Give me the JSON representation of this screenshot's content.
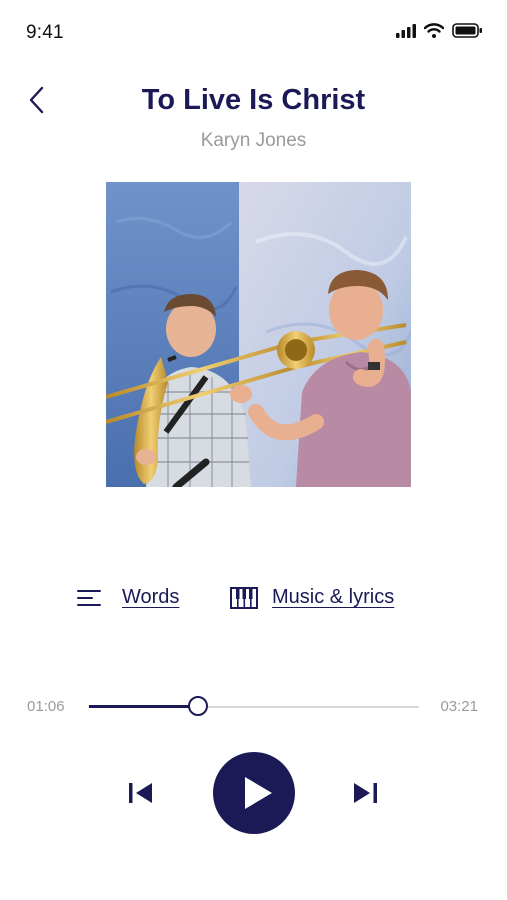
{
  "status_bar": {
    "time": "9:41",
    "icons": [
      "cellular-signal-icon",
      "wifi-icon",
      "battery-icon"
    ]
  },
  "header": {
    "back_icon": "chevron-left-icon",
    "title": "To Live Is Christ",
    "artist": "Karyn Jones"
  },
  "artwork": {
    "description_icon": "album-art-image"
  },
  "links": {
    "words": {
      "label": "Words",
      "icon": "text-lines-icon"
    },
    "music": {
      "label": "Music & lyrics",
      "icon": "piano-keys-icon"
    }
  },
  "player": {
    "current_time": "01:06",
    "total_time": "03:21",
    "progress": 0.33,
    "prev_icon": "skip-previous-icon",
    "play_icon": "play-icon",
    "next_icon": "skip-next-icon"
  },
  "colors": {
    "accent": "#1b1a57",
    "muted": "#9a9a9a",
    "track": "#d7d7dc"
  }
}
